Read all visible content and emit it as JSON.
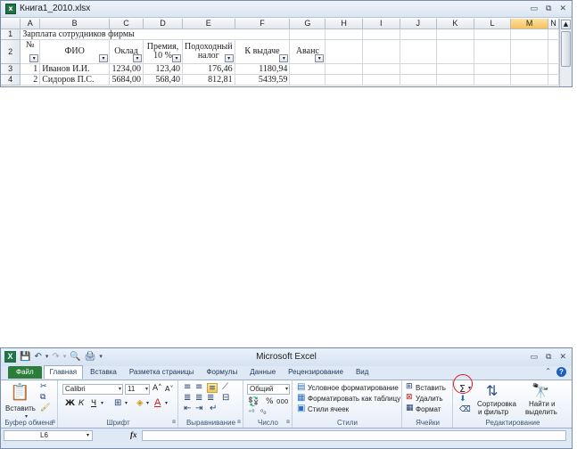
{
  "sheet_window": {
    "title": "Книга1_2010.xlsx",
    "controls": {
      "minimize": "▭",
      "restore": "⧉",
      "close": "✕"
    }
  },
  "grid": {
    "columns": [
      "",
      "A",
      "B",
      "C",
      "D",
      "E",
      "F",
      "G",
      "H",
      "I",
      "J",
      "K",
      "L",
      "M",
      "N"
    ],
    "selected_column": "M",
    "rows": {
      "r1_num": "1",
      "r1_title": "Зарплата сотрудников фирмы",
      "r2_num": "2",
      "h_num": "№",
      "h_fio": "ФИО",
      "h_oklad": "Оклад",
      "h_premia_1": "Премия,",
      "h_premia_2": "10 %",
      "h_nalog_1": "Подоходный",
      "h_nalog_2": "налог",
      "h_k_vydache": "К выдаче",
      "h_avans": "Аванс",
      "r3_num": "3",
      "r3_a": "1",
      "r3_b": "Иванов И.И.",
      "r3_c": "1234,00",
      "r3_d": "123,40",
      "r3_e": "176,46",
      "r3_f": "1180,94",
      "r4_num": "4",
      "r4_a": "2",
      "r4_b": "Сидоров П.С.",
      "r4_c": "5684,00",
      "r4_d": "568,40",
      "r4_e": "812,81",
      "r4_f": "5439,59"
    },
    "filter_glyph": "▾"
  },
  "excel": {
    "title": "Microsoft Excel",
    "logo_letter": "X",
    "qat": {
      "save": "💾",
      "undo": "↶",
      "undo_dd": "▾",
      "redo": "↷",
      "redo_dd": "▾",
      "print_preview": "🔍",
      "quick_print": "🖨",
      "customize": "▾"
    },
    "tabs": {
      "file": "Файл",
      "home": "Главная",
      "insert": "Вставка",
      "page_layout": "Разметка страницы",
      "formulas": "Формулы",
      "data": "Данные",
      "review": "Рецензирование",
      "view": "Вид"
    },
    "ribbon": {
      "clipboard": {
        "label": "Буфер обмена",
        "paste": "Вставить"
      },
      "font": {
        "label": "Шрифт",
        "font_name": "Calibri",
        "font_size": "11",
        "grow": "A˄",
        "shrink": "A˅",
        "bold": "Ж",
        "italic": "К",
        "underline": "Ч"
      },
      "alignment": {
        "label": "Выравнивание"
      },
      "number": {
        "label": "Число",
        "format": "Общий",
        "percent": "%",
        "thousands": "000"
      },
      "styles": {
        "label": "Стили",
        "conditional": "Условное форматирование",
        "as_table": "Форматировать как таблицу",
        "cell_styles": "Стили ячеек"
      },
      "cells": {
        "label": "Ячейки",
        "insert": "Вставить",
        "delete": "Удалить",
        "format": "Формат"
      },
      "editing": {
        "label": "Редактирование",
        "sum": "Σ",
        "sort_1": "Сортировка",
        "sort_2": "и фильтр",
        "find_1": "Найти и",
        "find_2": "выделить"
      }
    },
    "formula_bar": {
      "name_box": "L6",
      "fx": "fx",
      "value": ""
    }
  }
}
